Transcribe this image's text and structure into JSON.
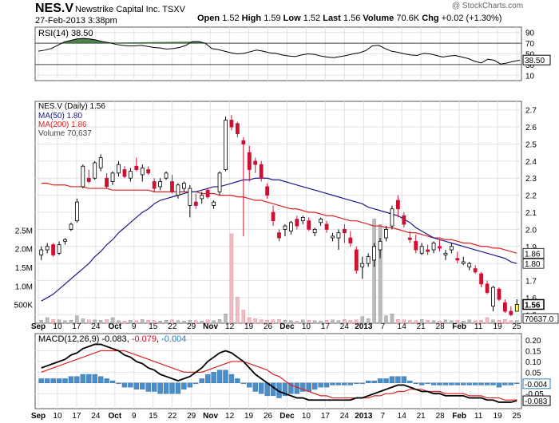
{
  "header": {
    "symbol": "NES.V",
    "company": "Newstrike Capital Inc.",
    "exchange": "TSXV",
    "date_time": "27-Feb-2013 3:38pm",
    "watermark": "@ StockCharts.com",
    "open_label": "Open",
    "open": "1.52",
    "high_label": "High",
    "high": "1.59",
    "low_label": "Low",
    "low": "1.52",
    "last_label": "Last",
    "last": "1.56",
    "volume_label": "Volume",
    "volume": "70.6K",
    "chg_label": "Chg",
    "chg": "+0.02 (+1.30%)"
  },
  "colors": {
    "up": "#000000",
    "down": "#cc1133",
    "ma50": "#1a1a8c",
    "ma200": "#dd2222",
    "volume": "#f2bcc4",
    "volume_up": "#bbbbbb",
    "macd_hist": "#4b8dc8",
    "rsi_fill": "#2e6b2e",
    "last_box": "#ffff66"
  },
  "chart_data": [
    {
      "type": "line",
      "panel": "rsi",
      "legend": "RSI(14) 38.50",
      "ylim": [
        0,
        100
      ],
      "ticks": [
        "90",
        "70",
        "50",
        "30",
        "10"
      ],
      "last_value": "38.50",
      "values": [
        55,
        57,
        60,
        66,
        72,
        75,
        78,
        79,
        78,
        76,
        73,
        71,
        68,
        66,
        65,
        65,
        66,
        64,
        62,
        61,
        59,
        60,
        62,
        66,
        73,
        73,
        70,
        60,
        58,
        55,
        52,
        50,
        51,
        54,
        57,
        55,
        52,
        51,
        48,
        46,
        45,
        48,
        50,
        49,
        46,
        44,
        43,
        45,
        47,
        50,
        52,
        56,
        65,
        66,
        60,
        55,
        53,
        50,
        48,
        47,
        51,
        50,
        47,
        44,
        46,
        47,
        44,
        41,
        36,
        33,
        40,
        38,
        31,
        33,
        36,
        38
      ]
    },
    {
      "type": "candlestick",
      "panel": "price",
      "legend": "NES.V (Daily) 1.56",
      "ma50_label": "MA(50) 1.80",
      "ma200_label": "MA(200) 1.86",
      "volume_label": "Volume 70,637",
      "ylim": [
        1.45,
        2.75
      ],
      "price_ticks": [
        "2.7",
        "2.6",
        "2.5",
        "2.4",
        "2.3",
        "2.2",
        "2.1",
        "2.0",
        "1.9",
        "1.8",
        "1.7",
        "1.6",
        "1.5"
      ],
      "volume_ticks": [
        "2.5M",
        "2.0M",
        "1.5M",
        "1.0M",
        "500K"
      ],
      "volume_max": 3000000,
      "right_tags": [
        "1.86",
        "1.80",
        "1.56",
        "70637.0"
      ],
      "x_ticks": [
        "Sep",
        "10",
        "17",
        "24",
        "Oct",
        "9",
        "15",
        "22",
        "29",
        "Nov",
        "12",
        "19",
        "26",
        "Dec",
        "10",
        "17",
        "24",
        "2013",
        "7",
        "14",
        "21",
        "28",
        "Feb",
        "11",
        "19",
        "25"
      ],
      "ohlc": [
        [
          1.85,
          1.9,
          1.82,
          1.88
        ],
        [
          1.88,
          1.92,
          1.86,
          1.9
        ],
        [
          1.91,
          1.92,
          1.84,
          1.85
        ],
        [
          1.86,
          1.93,
          1.85,
          1.91
        ],
        [
          1.93,
          1.95,
          1.91,
          1.94
        ],
        [
          2.0,
          2.04,
          1.99,
          2.03
        ],
        [
          2.05,
          2.18,
          2.04,
          2.16
        ],
        [
          2.25,
          2.38,
          2.24,
          2.37
        ],
        [
          2.3,
          2.35,
          2.27,
          2.28
        ],
        [
          2.3,
          2.4,
          2.29,
          2.39
        ],
        [
          2.36,
          2.44,
          2.34,
          2.42
        ],
        [
          2.3,
          2.33,
          2.24,
          2.25
        ],
        [
          2.28,
          2.34,
          2.26,
          2.33
        ],
        [
          2.33,
          2.4,
          2.31,
          2.38
        ],
        [
          2.35,
          2.37,
          2.3,
          2.31
        ],
        [
          2.3,
          2.36,
          2.28,
          2.34
        ],
        [
          2.37,
          2.42,
          2.34,
          2.35
        ],
        [
          2.32,
          2.38,
          2.28,
          2.36
        ],
        [
          2.35,
          2.37,
          2.32,
          2.33
        ],
        [
          2.28,
          2.3,
          2.22,
          2.24
        ],
        [
          2.25,
          2.3,
          2.23,
          2.28
        ],
        [
          2.3,
          2.34,
          2.29,
          2.33
        ],
        [
          2.28,
          2.32,
          2.21,
          2.22
        ],
        [
          2.2,
          2.27,
          2.18,
          2.26
        ],
        [
          2.24,
          2.28,
          2.22,
          2.27
        ],
        [
          2.14,
          2.26,
          2.07,
          2.24
        ],
        [
          2.16,
          2.21,
          2.12,
          2.14
        ],
        [
          2.18,
          2.22,
          2.15,
          2.2
        ],
        [
          2.23,
          2.24,
          2.18,
          2.19
        ],
        [
          2.14,
          2.17,
          2.12,
          2.16
        ],
        [
          2.22,
          2.34,
          2.2,
          2.33
        ],
        [
          2.35,
          2.66,
          2.34,
          2.64
        ],
        [
          2.64,
          2.67,
          2.58,
          2.6
        ],
        [
          2.62,
          2.63,
          2.54,
          2.56
        ],
        [
          2.52,
          2.54,
          1.96,
          2.5
        ],
        [
          2.45,
          2.49,
          2.28,
          2.35
        ],
        [
          2.4,
          2.42,
          2.33,
          2.38
        ],
        [
          2.38,
          2.4,
          2.28,
          2.3
        ],
        [
          2.25,
          2.27,
          2.18,
          2.2
        ],
        [
          2.1,
          2.14,
          2.02,
          2.05
        ],
        [
          1.98,
          2.0,
          1.93,
          1.95
        ],
        [
          2.0,
          2.03,
          1.96,
          2.02
        ],
        [
          1.99,
          2.05,
          1.97,
          2.04
        ],
        [
          2.06,
          2.08,
          2.0,
          2.02
        ],
        [
          2.05,
          2.08,
          2.03,
          2.07
        ],
        [
          2.05,
          2.07,
          1.99,
          2.0
        ],
        [
          1.98,
          2.01,
          1.96,
          2.0
        ],
        [
          2.04,
          2.07,
          2.02,
          2.06
        ],
        [
          2.03,
          2.05,
          1.98,
          2.0
        ],
        [
          1.95,
          1.98,
          1.93,
          1.96
        ],
        [
          1.95,
          2.0,
          1.88,
          1.98
        ],
        [
          2.0,
          2.03,
          1.92,
          1.98
        ],
        [
          1.95,
          1.99,
          1.9,
          1.92
        ],
        [
          1.88,
          1.9,
          1.74,
          1.76
        ],
        [
          1.78,
          1.84,
          1.71,
          1.8
        ],
        [
          1.8,
          1.86,
          1.78,
          1.84
        ],
        [
          1.82,
          1.92,
          1.78,
          1.9
        ],
        [
          1.88,
          1.95,
          1.83,
          1.93
        ],
        [
          1.95,
          2.02,
          1.93,
          2.0
        ],
        [
          2.02,
          2.14,
          2.0,
          2.12
        ],
        [
          2.17,
          2.2,
          2.07,
          2.12
        ],
        [
          2.08,
          2.1,
          2.01,
          2.03
        ],
        [
          1.95,
          1.99,
          1.92,
          1.94
        ],
        [
          1.93,
          1.97,
          1.86,
          1.88
        ],
        [
          1.86,
          1.92,
          1.85,
          1.9
        ],
        [
          1.88,
          1.91,
          1.85,
          1.87
        ],
        [
          1.88,
          1.93,
          1.86,
          1.92
        ],
        [
          1.9,
          1.94,
          1.87,
          1.89
        ],
        [
          1.85,
          1.88,
          1.82,
          1.86
        ],
        [
          1.88,
          1.92,
          1.86,
          1.9
        ],
        [
          1.83,
          1.87,
          1.8,
          1.82
        ],
        [
          1.8,
          1.84,
          1.79,
          1.81
        ],
        [
          1.78,
          1.81,
          1.76,
          1.8
        ],
        [
          1.77,
          1.79,
          1.74,
          1.75
        ],
        [
          1.74,
          1.75,
          1.66,
          1.68
        ],
        [
          1.68,
          1.7,
          1.62,
          1.63
        ],
        [
          1.55,
          1.67,
          1.52,
          1.66
        ],
        [
          1.65,
          1.66,
          1.58,
          1.59
        ],
        [
          1.57,
          1.59,
          1.51,
          1.52
        ],
        [
          1.52,
          1.55,
          1.49,
          1.5
        ],
        [
          1.52,
          1.59,
          1.52,
          1.56
        ]
      ],
      "volume": [
        80000,
        150000,
        100000,
        90000,
        70000,
        80000,
        200000,
        120000,
        90000,
        90000,
        80000,
        100000,
        150000,
        70000,
        60000,
        80000,
        70000,
        100000,
        80000,
        70000,
        60000,
        80000,
        90000,
        70000,
        60000,
        80000,
        70000,
        60000,
        90000,
        70000,
        100000,
        250000,
        2400000,
        700000,
        350000,
        150000,
        120000,
        90000,
        80000,
        90000,
        100000,
        80000,
        70000,
        60000,
        90000,
        80000,
        70000,
        60000,
        80000,
        90000,
        70000,
        100000,
        80000,
        90000,
        180000,
        120000,
        2800000,
        2650000,
        200000,
        250000,
        100000,
        90000,
        80000,
        70000,
        100000,
        80000,
        70000,
        60000,
        90000,
        70000,
        80000,
        60000,
        90000,
        70000,
        80000,
        150000,
        90000,
        80000,
        100000,
        70000,
        70637
      ],
      "ma50": [
        1.58,
        1.6,
        1.62,
        1.65,
        1.68,
        1.71,
        1.74,
        1.77,
        1.8,
        1.84,
        1.87,
        1.91,
        1.94,
        1.98,
        2.01,
        2.04,
        2.07,
        2.1,
        2.12,
        2.15,
        2.17,
        2.18,
        2.19,
        2.2,
        2.21,
        2.22,
        2.22,
        2.23,
        2.24,
        2.25,
        2.25,
        2.26,
        2.27,
        2.28,
        2.29,
        2.29,
        2.3,
        2.3,
        2.3,
        2.29,
        2.29,
        2.28,
        2.27,
        2.26,
        2.25,
        2.24,
        2.23,
        2.22,
        2.21,
        2.2,
        2.19,
        2.18,
        2.17,
        2.16,
        2.15,
        2.13,
        2.12,
        2.11,
        2.1,
        2.09,
        2.08,
        2.06,
        2.04,
        2.01,
        1.99,
        1.97,
        1.95,
        1.94,
        1.93,
        1.92,
        1.91,
        1.9,
        1.89,
        1.88,
        1.87,
        1.86,
        1.85,
        1.84,
        1.83,
        1.81,
        1.8
      ],
      "ma200": [
        2.27,
        2.27,
        2.26,
        2.26,
        2.26,
        2.25,
        2.25,
        2.25,
        2.24,
        2.24,
        2.24,
        2.24,
        2.23,
        2.23,
        2.23,
        2.23,
        2.23,
        2.23,
        2.23,
        2.22,
        2.22,
        2.22,
        2.22,
        2.22,
        2.22,
        2.22,
        2.22,
        2.21,
        2.21,
        2.21,
        2.2,
        2.2,
        2.2,
        2.19,
        2.19,
        2.18,
        2.17,
        2.17,
        2.16,
        2.15,
        2.14,
        2.13,
        2.12,
        2.12,
        2.11,
        2.1,
        2.1,
        2.09,
        2.08,
        2.08,
        2.07,
        2.06,
        2.05,
        2.05,
        2.04,
        2.03,
        2.02,
        2.02,
        2.01,
        2.01,
        2.0,
        1.99,
        1.98,
        1.98,
        1.97,
        1.96,
        1.95,
        1.95,
        1.94,
        1.94,
        1.93,
        1.92,
        1.92,
        1.91,
        1.9,
        1.9,
        1.89,
        1.89,
        1.88,
        1.87,
        1.86
      ]
    },
    {
      "type": "line",
      "panel": "macd",
      "legend_prefix": "MACD(12,26,9)",
      "legend_macd": "-0.083",
      "legend_signal": "-0.079",
      "legend_hist": "-0.004",
      "ylim": [
        -0.12,
        0.23
      ],
      "ticks": [
        "0.20",
        "0.15",
        "0.10",
        "0.05",
        "0.00",
        "-0.05"
      ],
      "right_tags": [
        "-0.004",
        "-0.083"
      ],
      "macd": [
        0.07,
        0.08,
        0.09,
        0.1,
        0.11,
        0.13,
        0.14,
        0.16,
        0.17,
        0.18,
        0.18,
        0.17,
        0.16,
        0.15,
        0.13,
        0.12,
        0.1,
        0.09,
        0.07,
        0.06,
        0.04,
        0.03,
        0.02,
        0.01,
        0.02,
        0.03,
        0.05,
        0.07,
        0.1,
        0.12,
        0.14,
        0.15,
        0.14,
        0.12,
        0.1,
        0.07,
        0.04,
        0.02,
        0.0,
        -0.02,
        -0.04,
        -0.05,
        -0.06,
        -0.07,
        -0.07,
        -0.08,
        -0.08,
        -0.08,
        -0.08,
        -0.08,
        -0.08,
        -0.08,
        -0.08,
        -0.07,
        -0.07,
        -0.06,
        -0.05,
        -0.04,
        -0.03,
        -0.02,
        -0.01,
        -0.01,
        -0.02,
        -0.03,
        -0.04,
        -0.04,
        -0.05,
        -0.05,
        -0.06,
        -0.06,
        -0.06,
        -0.06,
        -0.07,
        -0.07,
        -0.07,
        -0.08,
        -0.08,
        -0.09,
        -0.09,
        -0.09,
        -0.083
      ],
      "signal": [
        0.05,
        0.06,
        0.07,
        0.08,
        0.09,
        0.1,
        0.11,
        0.12,
        0.13,
        0.14,
        0.15,
        0.15,
        0.15,
        0.15,
        0.15,
        0.14,
        0.13,
        0.12,
        0.11,
        0.1,
        0.09,
        0.08,
        0.07,
        0.06,
        0.05,
        0.05,
        0.05,
        0.05,
        0.06,
        0.07,
        0.08,
        0.09,
        0.1,
        0.1,
        0.1,
        0.09,
        0.08,
        0.07,
        0.06,
        0.04,
        0.03,
        0.01,
        -0.01,
        -0.02,
        -0.03,
        -0.04,
        -0.05,
        -0.06,
        -0.06,
        -0.07,
        -0.07,
        -0.07,
        -0.07,
        -0.07,
        -0.07,
        -0.07,
        -0.06,
        -0.06,
        -0.05,
        -0.05,
        -0.04,
        -0.04,
        -0.03,
        -0.03,
        -0.03,
        -0.04,
        -0.04,
        -0.04,
        -0.05,
        -0.05,
        -0.05,
        -0.05,
        -0.06,
        -0.06,
        -0.06,
        -0.07,
        -0.07,
        -0.07,
        -0.08,
        -0.08,
        -0.079
      ],
      "histogram": [
        0.02,
        0.02,
        0.02,
        0.02,
        0.02,
        0.03,
        0.03,
        0.04,
        0.04,
        0.04,
        0.03,
        0.02,
        0.01,
        0.0,
        -0.02,
        -0.02,
        -0.03,
        -0.03,
        -0.04,
        -0.04,
        -0.05,
        -0.05,
        -0.05,
        -0.05,
        -0.03,
        -0.02,
        0.0,
        0.02,
        0.04,
        0.05,
        0.06,
        0.06,
        0.04,
        0.02,
        0.0,
        -0.02,
        -0.04,
        -0.05,
        -0.06,
        -0.06,
        -0.07,
        -0.06,
        -0.05,
        -0.05,
        -0.04,
        -0.04,
        -0.03,
        -0.02,
        -0.02,
        -0.01,
        -0.01,
        -0.01,
        -0.01,
        0.0,
        0.0,
        0.01,
        0.01,
        0.02,
        0.02,
        0.03,
        0.03,
        0.03,
        0.01,
        0.0,
        -0.01,
        0.0,
        -0.01,
        -0.01,
        -0.01,
        -0.01,
        -0.01,
        -0.01,
        -0.01,
        -0.01,
        -0.01,
        -0.01,
        -0.01,
        -0.02,
        -0.01,
        -0.01,
        -0.004
      ]
    }
  ]
}
